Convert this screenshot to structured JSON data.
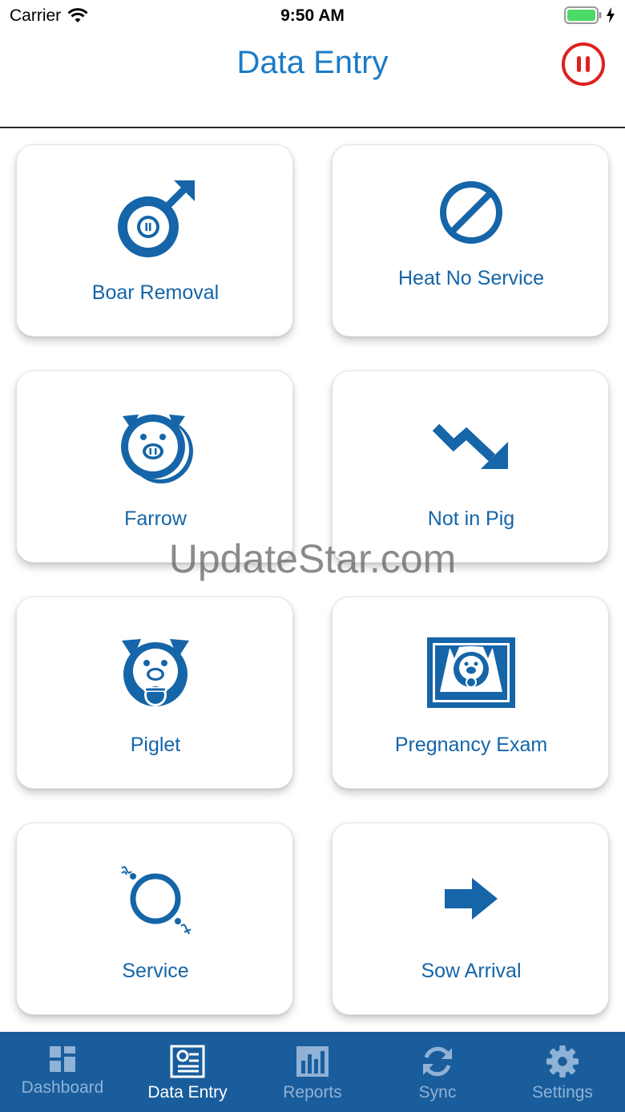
{
  "status_bar": {
    "carrier": "Carrier",
    "time": "9:50 AM"
  },
  "nav": {
    "title": "Data Entry",
    "pause_icon": "pause-circle-icon"
  },
  "tiles": [
    {
      "label": "Boar Removal",
      "icon": "male-symbol-icon"
    },
    {
      "label": "Heat No Service",
      "icon": "prohibited-icon"
    },
    {
      "label": "Farrow",
      "icon": "sow-litter-icon"
    },
    {
      "label": "Not in Pig",
      "icon": "trend-down-arrow-icon"
    },
    {
      "label": "Piglet",
      "icon": "piglet-pacifier-icon"
    },
    {
      "label": "Pregnancy Exam",
      "icon": "ultrasound-icon"
    },
    {
      "label": "Service",
      "icon": "service-ring-icon"
    },
    {
      "label": "Sow Arrival",
      "icon": "arrow-right-icon"
    }
  ],
  "watermark": "UpdateStar.com",
  "tab_bar": {
    "tabs": [
      {
        "label": "Dashboard",
        "icon": "dashboard-icon"
      },
      {
        "label": "Data Entry",
        "icon": "data-entry-icon"
      },
      {
        "label": "Reports",
        "icon": "reports-icon"
      },
      {
        "label": "Sync",
        "icon": "sync-icon"
      },
      {
        "label": "Settings",
        "icon": "gear-icon"
      }
    ],
    "active": "Data Entry"
  },
  "colors": {
    "primary": "#1565a8",
    "title": "#1a7bc7",
    "tab_bar": "#1a5d9c",
    "pause_red": "#e02020",
    "battery_green": "#4cd964"
  }
}
